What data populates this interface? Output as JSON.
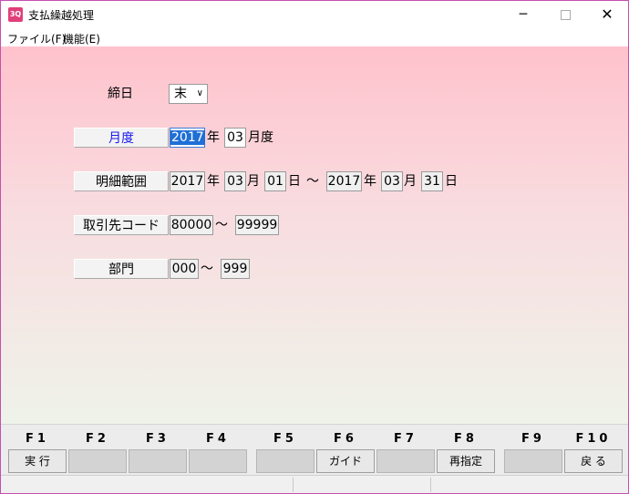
{
  "window": {
    "title": "支払繰越処理",
    "icon_text": "3Q",
    "controls": {
      "minimize": "─",
      "maximize": "☐",
      "close": "✕"
    }
  },
  "menu": [
    {
      "label": "ファイル(F)"
    },
    {
      "label": "機能(E)"
    }
  ],
  "form": {
    "closing_day": {
      "label": "締日",
      "value": "末"
    },
    "month": {
      "label": "月度",
      "year": "2017",
      "year_suffix": "年",
      "month": "03",
      "month_suffix": "月度"
    },
    "detail_range": {
      "label": "明細範囲",
      "from_year": "2017",
      "from_month": "03",
      "from_day": "01",
      "to_year": "2017",
      "to_month": "03",
      "to_day": "31",
      "year_suffix": "年",
      "month_suffix": "月",
      "day_suffix": "日",
      "tilde": "～"
    },
    "supplier_code": {
      "label": "取引先コード",
      "from": "80000",
      "to": "99999",
      "tilde": "～"
    },
    "department": {
      "label": "部門",
      "from": "000",
      "to": "999",
      "tilde": "～"
    }
  },
  "function_keys": [
    {
      "key": "F1",
      "label": "実 行"
    },
    {
      "key": "F2",
      "label": ""
    },
    {
      "key": "F3",
      "label": ""
    },
    {
      "key": "F4",
      "label": ""
    },
    {
      "key": "F5",
      "label": ""
    },
    {
      "key": "F6",
      "label": "ガイド"
    },
    {
      "key": "F7",
      "label": ""
    },
    {
      "key": "F8",
      "label": "再指定"
    },
    {
      "key": "F9",
      "label": ""
    },
    {
      "key": "F10",
      "label": "戻 る"
    }
  ],
  "colors": {
    "accent": "#1e6fd6",
    "label_blue": "#1a1aee",
    "bg_top": "#ffc2cc",
    "bg_bottom": "#eef3e9"
  }
}
